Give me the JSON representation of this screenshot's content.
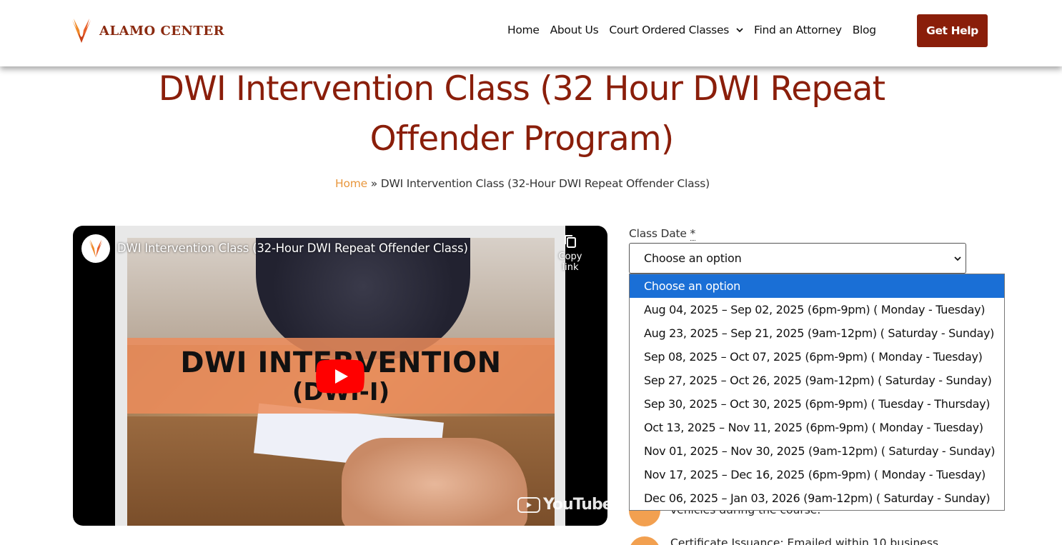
{
  "header": {
    "logo_text": "ALAMO CENTER",
    "nav": [
      "Home",
      "About Us",
      "Court Ordered Classes",
      "Find an Attorney",
      "Blog"
    ],
    "cta": "Get Help"
  },
  "page": {
    "title_line1": "DWI Intervention Class (32 Hour DWI Repeat",
    "title_line2": "Offender Program)",
    "breadcrumb_home": "Home",
    "breadcrumb_sep": " » ",
    "breadcrumb_current": "DWI Intervention Class (32-Hour DWI Repeat Offender Class)"
  },
  "video": {
    "title": "DWI Intervention Class (32-Hour DWI Repeat Offender Class)",
    "copy_link": "Copy link",
    "banner_line1": "DWI INTERVENTION",
    "banner_line2": "(DWI-I)",
    "brand": "YouTube"
  },
  "form": {
    "label": "Class Date",
    "required_mark": "*",
    "selected": "Choose an option",
    "options": [
      "Choose an option",
      "Aug 04, 2025 – Sep 02, 2025 (6pm-9pm) ( Monday - Tuesday)",
      "Aug 23, 2025 – Sep 21, 2025 (9am-12pm) ( Saturday - Sunday)",
      "Sep 08, 2025 – Oct 07, 2025 (6pm-9pm) ( Monday - Tuesday)",
      "Sep 27, 2025 – Oct 26, 2025 (9am-12pm) ( Saturday - Sunday)",
      "Sep 30, 2025 – Oct 30, 2025 (6pm-9pm) ( Tuesday - Thursday)",
      "Oct 13, 2025 – Nov 11, 2025 (6pm-9pm) ( Monday - Tuesday)",
      "Nov 01, 2025 – Nov 30, 2025 (9am-12pm) ( Saturday - Sunday)",
      "Nov 17, 2025 – Dec 16, 2025 (6pm-9pm) ( Monday - Tuesday)",
      "Dec 06, 2025 – Jan 03, 2026 (9am-12pm) ( Saturday - Sunday)"
    ]
  },
  "features": {
    "item1_partial": "vehicles during the course.",
    "item2_partial": "Certificate Issuance: Emailed within 10 business"
  },
  "colors": {
    "brand": "#8a1e0a",
    "accent": "#e8963c",
    "highlight": "#1a6fd6"
  }
}
